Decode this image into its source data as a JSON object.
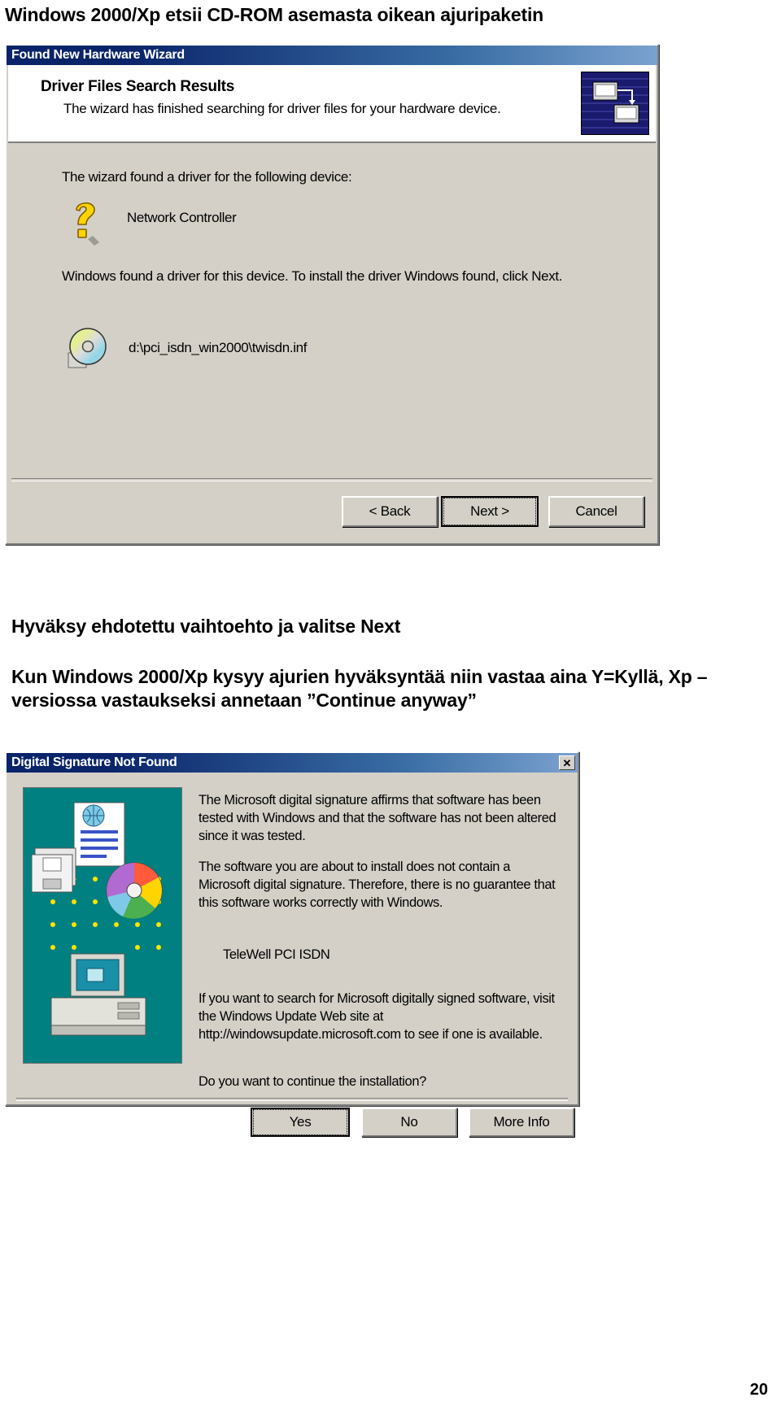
{
  "document": {
    "title_line": "Windows 2000/Xp etsii CD-ROM asemasta oikean ajuripaketin",
    "caption_next": "Hyväksy ehdotettu vaihtoehto ja valitse Next",
    "caption_accept": "Kun Windows 2000/Xp kysyy ajurien hyväksyntää niin vastaa aina Y=Kyllä, Xp –versiossa vastaukseksi annetaan ”Continue anyway”",
    "page_number": "20"
  },
  "wizard_dialog": {
    "titlebar": "Found New Hardware Wizard",
    "heading": "Driver Files Search Results",
    "subheading": "The wizard has finished searching for driver files for your hardware device.",
    "found_text": "The wizard found a driver for the following device:",
    "device_name": "Network Controller",
    "install_text": "Windows found a driver for this device. To install the driver Windows found, click Next.",
    "inf_path": "d:\\pci_isdn_win2000\\twisdn.inf",
    "buttons": {
      "back": "< Back",
      "next": "Next >",
      "cancel": "Cancel"
    },
    "icons": {
      "banner": "wizard-banner-icon",
      "device": "question-mark-icon",
      "media": "cd-disc-icon"
    }
  },
  "signature_dialog": {
    "titlebar": "Digital Signature Not Found",
    "close_label": "✕",
    "paragraph_1": "The Microsoft digital signature affirms that software has been tested with Windows and that the software has not been altered since it was tested.",
    "paragraph_2": "The software you are about to install does not contain a Microsoft digital signature. Therefore, there is no guarantee that this software works correctly with Windows.",
    "device_name": "TeleWell PCI ISDN",
    "paragraph_4": "If you want to search for Microsoft digitally signed software, visit the Windows Update Web site at http://windowsupdate.microsoft.com to see if one is available.",
    "paragraph_5": "Do you want to continue the installation?",
    "buttons": {
      "yes": "Yes",
      "no": "No",
      "more_info": "More Info"
    },
    "artwork": "digital-signature-illustration"
  },
  "colors": {
    "titlebar_start": "#0a246a",
    "titlebar_end": "#7ba2d0",
    "dialog_face": "#d4d0c8",
    "art_background": "#008080",
    "banner_background": "#1a1a6e"
  }
}
